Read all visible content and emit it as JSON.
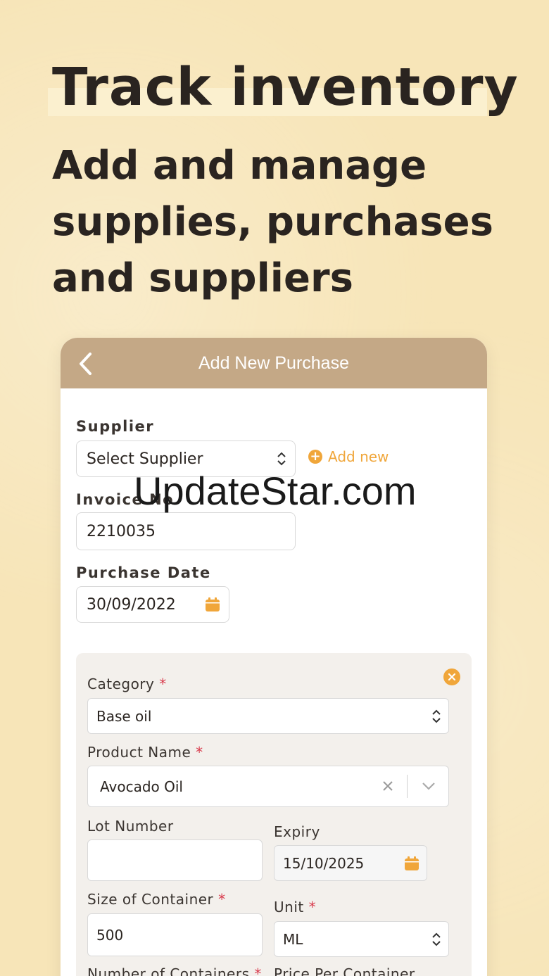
{
  "promo": {
    "headline": "Track inventory",
    "subhead_lines": [
      "Add and manage",
      "supplies, purchases",
      "and suppliers"
    ]
  },
  "header": {
    "title": "Add New Purchase"
  },
  "form": {
    "supplier_label": "Supplier",
    "supplier_value": "Select Supplier",
    "add_new_label": "Add new",
    "invoice_label": "Invoice No",
    "invoice_value": "2210035",
    "purchase_date_label": "Purchase Date",
    "purchase_date_value": "30/09/2022"
  },
  "item": {
    "category_label": "Category",
    "category_value": "Base oil",
    "product_label": "Product Name",
    "product_value": "Avocado Oil",
    "lot_label": "Lot Number",
    "lot_value": "",
    "expiry_label": "Expiry",
    "expiry_value": "15/10/2025",
    "size_label": "Size of Container",
    "size_value": "500",
    "unit_label": "Unit",
    "unit_value": "ML",
    "num_containers_label": "Number of Containers",
    "price_label": "Price Per Container",
    "required_mark": "*"
  },
  "watermark": "UpdateStar.com",
  "colors": {
    "accent": "#f0a63a",
    "header": "#c4a886",
    "background": "#f7e5b8",
    "required": "#d8384a"
  },
  "icons": [
    "chevron-left-icon",
    "updown-chevron-icon",
    "plus-circle-icon",
    "calendar-icon",
    "close-circle-icon",
    "clear-x-icon",
    "chevron-down-icon"
  ]
}
